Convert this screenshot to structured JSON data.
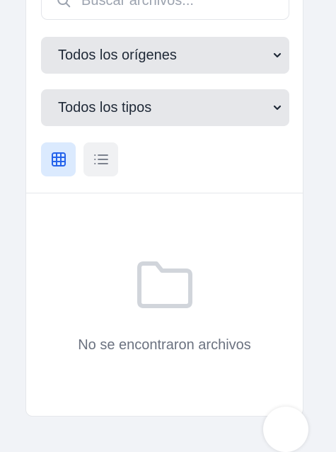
{
  "search": {
    "placeholder": "Buscar archivos..."
  },
  "filters": {
    "origin_selected": "Todos los orígenes",
    "type_selected": "Todos los tipos"
  },
  "view_toggle": {
    "active": "grid",
    "options": [
      "grid",
      "list"
    ]
  },
  "empty_state": {
    "icon": "folder-icon",
    "message": "No se encontraron archivos"
  },
  "colors": {
    "accent": "#2563eb",
    "active_bg": "#dbeafe",
    "select_bg": "#e6e7ea",
    "page_bg": "#f1f3f7"
  }
}
